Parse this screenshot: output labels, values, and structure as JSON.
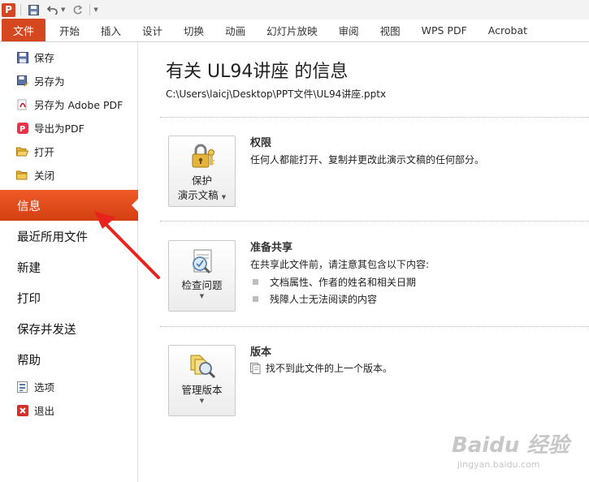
{
  "qat": {
    "app_letter": "P"
  },
  "tabs": [
    {
      "label": "文件"
    },
    {
      "label": "开始"
    },
    {
      "label": "插入"
    },
    {
      "label": "设计"
    },
    {
      "label": "切换"
    },
    {
      "label": "动画"
    },
    {
      "label": "幻灯片放映"
    },
    {
      "label": "审阅"
    },
    {
      "label": "视图"
    },
    {
      "label": "WPS PDF"
    },
    {
      "label": "Acrobat"
    }
  ],
  "nav": {
    "small_top": [
      {
        "label": "保存",
        "icon": "save-icon"
      },
      {
        "label": "另存为",
        "icon": "save-as-icon"
      },
      {
        "label": "另存为 Adobe PDF",
        "icon": "adobe-pdf-icon"
      },
      {
        "label": "导出为PDF",
        "icon": "export-pdf-icon"
      },
      {
        "label": "打开",
        "icon": "open-folder-icon"
      },
      {
        "label": "关闭",
        "icon": "close-folder-icon"
      }
    ],
    "big": [
      {
        "label": "信息",
        "active": true
      },
      {
        "label": "最近所用文件"
      },
      {
        "label": "新建"
      },
      {
        "label": "打印"
      },
      {
        "label": "保存并发送"
      },
      {
        "label": "帮助"
      }
    ],
    "small_bottom": [
      {
        "label": "选项",
        "icon": "options-icon"
      },
      {
        "label": "退出",
        "icon": "exit-icon"
      }
    ]
  },
  "info": {
    "title": "有关 UL94讲座 的信息",
    "path": "C:\\Users\\laicj\\Desktop\\PPT文件\\UL94讲座.pptx",
    "permissions": {
      "button_line1": "保护",
      "button_line2": "演示文稿",
      "heading": "权限",
      "text": "任何人都能打开、复制并更改此演示文稿的任何部分。"
    },
    "sharing": {
      "button_label": "检查问题",
      "heading": "准备共享",
      "text": "在共享此文件前，请注意其包含以下内容:",
      "bullets": [
        "文档属性、作者的姓名和相关日期",
        "残障人士无法阅读的内容"
      ]
    },
    "versions": {
      "button_label": "管理版本",
      "heading": "版本",
      "text": "找不到此文件的上一个版本。"
    }
  },
  "watermark": {
    "main": "Baidu 经验",
    "sub": "jingyan.baidu.com"
  },
  "colors": {
    "accent": "#d5471f",
    "arrow": "#e8231e"
  }
}
